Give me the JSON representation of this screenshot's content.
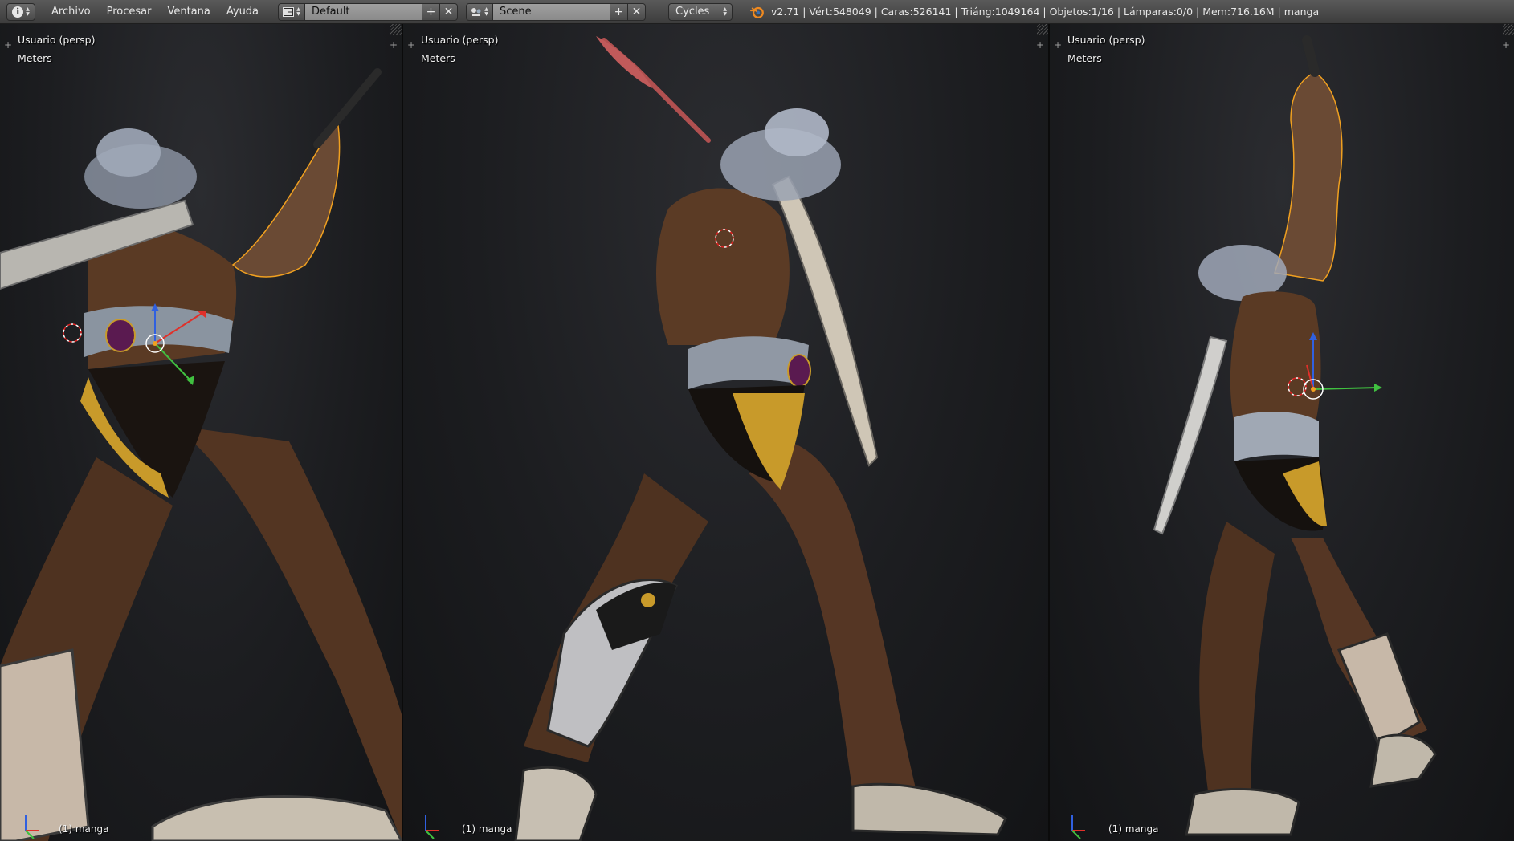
{
  "header": {
    "editor_icon": "info-icon",
    "menus": [
      "Archivo",
      "Procesar",
      "Ventana",
      "Ayuda"
    ],
    "screen_layout": {
      "icon": "screen-layout-icon",
      "value": "Default"
    },
    "scene": {
      "icon": "scene-icon",
      "value": "Scene"
    },
    "render_engine": "Cycles",
    "stats": "v2.71 | Vért:548049 | Caras:526141 | Triáng:1049164 | Objetos:1/16 | Lámparas:0/0 | Mem:716.16M | manga"
  },
  "viewports": [
    {
      "view": "Usuario (persp)",
      "units": "Meters",
      "object": "(1) manga"
    },
    {
      "view": "Usuario (persp)",
      "units": "Meters",
      "object": "(1) manga"
    },
    {
      "view": "Usuario (persp)",
      "units": "Meters",
      "object": "(1) manga"
    }
  ],
  "colors": {
    "header_bg": "#4a4a4a",
    "viewport_bg": "#1e1f22",
    "selection_outline": "#f0a020",
    "axis_x": "#e0302a",
    "axis_y": "#40c040",
    "axis_z": "#3060e0",
    "skin": "#5a3a24",
    "loincloth": "#c89a2a"
  }
}
